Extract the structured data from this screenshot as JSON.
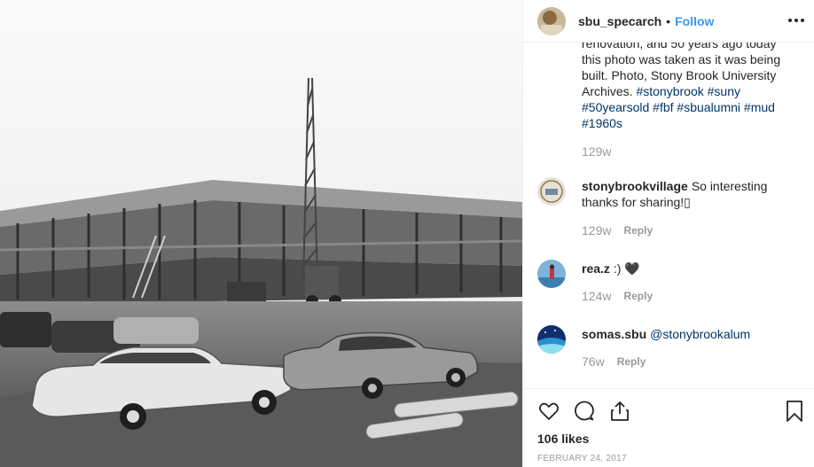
{
  "post": {
    "username": "sbu_specarch",
    "separator": "•",
    "follow_label": "Follow",
    "more_icon": "more-options-icon"
  },
  "caption": {
    "line1": "renovation, and 50 years ago today",
    "line2": "this photo was taken as it was being",
    "line3": "built. Photo, Stony Brook University",
    "line4_text": "Archives. ",
    "tags": [
      "#stonybrook",
      "#suny",
      "#50yearsold",
      "#fbf",
      "#sbualumni",
      "#mud",
      "#1960s"
    ],
    "time": "129w"
  },
  "comments": [
    {
      "user": "stonybrookvillage",
      "text_line1": "So interesting",
      "text_line2": "thanks for sharing!",
      "emoji": "▯",
      "time": "129w",
      "reply": "Reply"
    },
    {
      "user": "rea.z",
      "text": ":) ",
      "emoji": "🖤",
      "time": "124w",
      "reply": "Reply"
    },
    {
      "user": "somas.sbu",
      "mention": "@stonybrookalum",
      "time": "76w",
      "reply": "Reply"
    }
  ],
  "footer": {
    "likes": "106 likes",
    "date": "FEBRUARY 24, 2017"
  },
  "colors": {
    "link": "#3897f0",
    "hashtag": "#003569",
    "muted": "#999999"
  }
}
